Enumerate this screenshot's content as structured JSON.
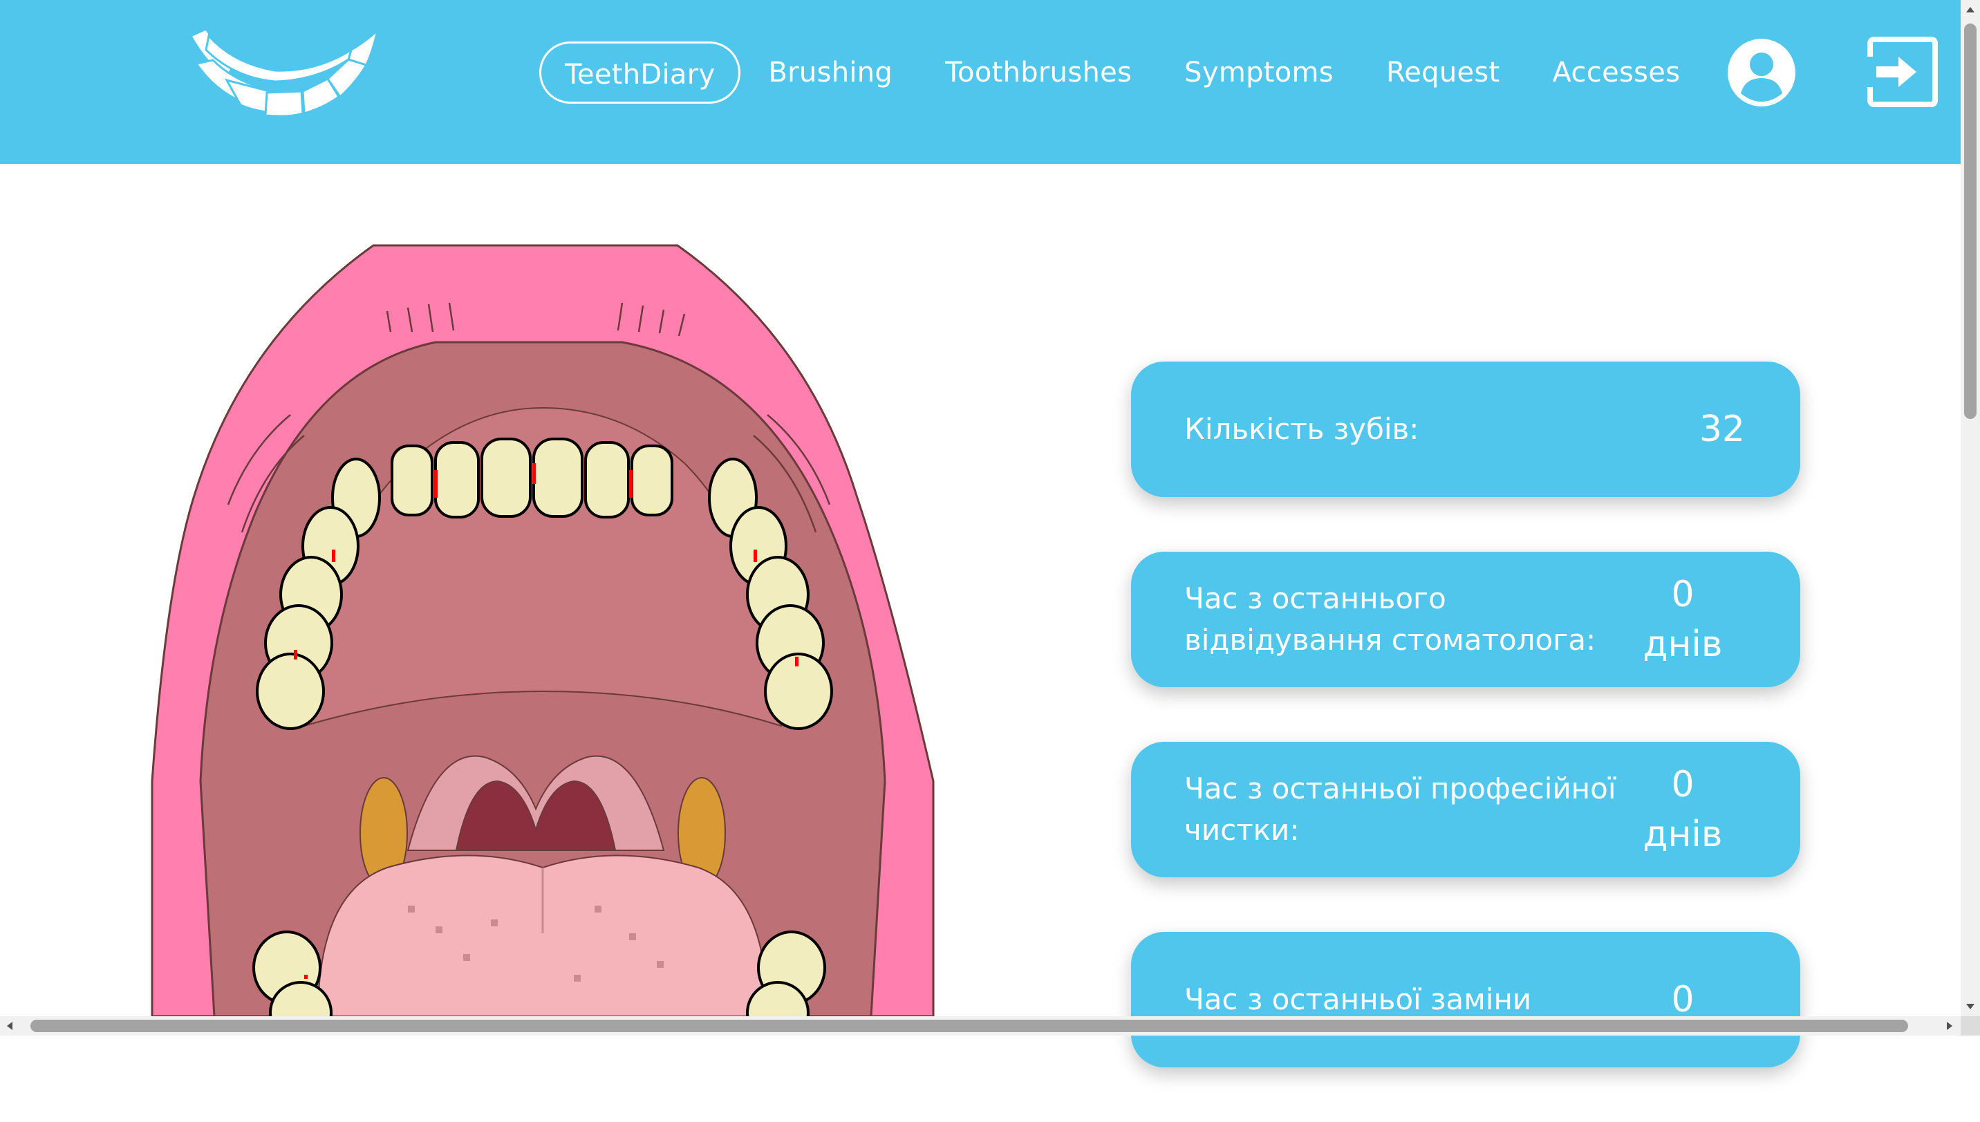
{
  "app": {
    "brand_color": "#51c6ec"
  },
  "nav": {
    "items": [
      {
        "label": "TeethDiary",
        "active": true
      },
      {
        "label": "Brushing",
        "active": false
      },
      {
        "label": "Toothbrushes",
        "active": false
      },
      {
        "label": "Symptoms",
        "active": false
      },
      {
        "label": "Request",
        "active": false
      },
      {
        "label": "Accesses",
        "active": false
      }
    ],
    "user_icon": "user-circle-icon",
    "logout_icon": "sign-out-icon"
  },
  "stats": [
    {
      "label": "Кількість зубів:",
      "value": "32",
      "unit": ""
    },
    {
      "label": "Час з останнього відвідування стоматолога:",
      "value": "0",
      "unit": "днів"
    },
    {
      "label": "Час з останньої професійної чистки:",
      "value": "0",
      "unit": "днів"
    },
    {
      "label": "Час з останньої заміни",
      "value": "0",
      "unit": ""
    }
  ]
}
